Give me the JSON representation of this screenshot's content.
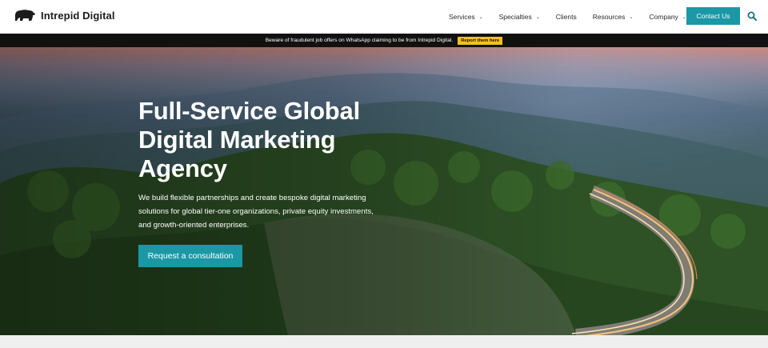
{
  "brand": {
    "name": "Intrepid Digital",
    "logo_icon": "bear-icon"
  },
  "nav": {
    "items": [
      {
        "label": "Services",
        "dropdown": true
      },
      {
        "label": "Specialties",
        "dropdown": true
      },
      {
        "label": "Clients",
        "dropdown": false
      },
      {
        "label": "Resources",
        "dropdown": true
      },
      {
        "label": "Company",
        "dropdown": true
      }
    ],
    "contact_label": "Contact Us",
    "search_icon": "search-icon"
  },
  "alert": {
    "text": "Beware of fraudulent job offers on WhatsApp claiming to be from Intrepid Digital.",
    "button_label": "Report them here"
  },
  "hero": {
    "title_lines": [
      "Full-Service Global",
      "Digital Marketing",
      "Agency"
    ],
    "subtitle_lines": [
      "We build flexible partnerships and create bespoke digital marketing",
      "solutions for global tier-one organizations, private equity investments,",
      "and growth-oriented enterprises."
    ],
    "cta_label": "Request a consultation"
  },
  "colors": {
    "accent": "#1a98a6",
    "alert_bg": "#111111",
    "alert_button": "#f5c21b"
  }
}
